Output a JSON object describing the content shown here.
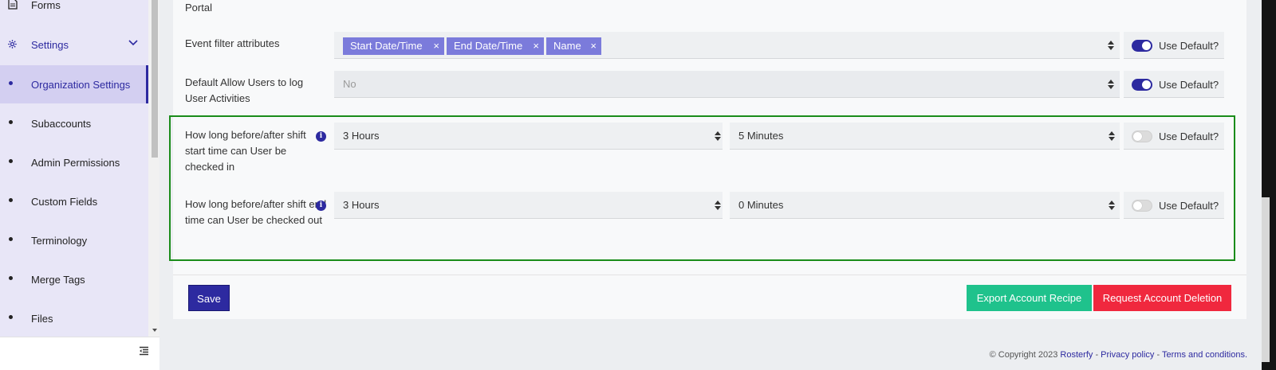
{
  "sidebar": {
    "items": [
      {
        "label": "Forms"
      },
      {
        "label": "Settings"
      },
      {
        "label": "Organization Settings"
      },
      {
        "label": "Subaccounts"
      },
      {
        "label": "Admin Permissions"
      },
      {
        "label": "Custom Fields"
      },
      {
        "label": "Terminology"
      },
      {
        "label": "Merge Tags"
      },
      {
        "label": "Files"
      }
    ]
  },
  "form": {
    "portal_label": "Portal",
    "event_filter": {
      "label": "Event filter attributes",
      "chips": [
        "Start Date/Time",
        "End Date/Time",
        "Name"
      ],
      "chip_remove": "×",
      "use_default_label": "Use Default?",
      "use_default_on": true
    },
    "allow_log": {
      "label": "Default Allow Users to log User Activities",
      "value": "No",
      "use_default_label": "Use Default?",
      "use_default_on": true
    },
    "checkin": {
      "label": "How long before/after shift start time can User be checked in",
      "hours": "3 Hours",
      "minutes": "5 Minutes",
      "use_default_label": "Use Default?",
      "use_default_on": false
    },
    "checkout": {
      "label": "How long before/after shift end time can User be checked out",
      "hours": "3 Hours",
      "minutes": "0 Minutes",
      "use_default_label": "Use Default?",
      "use_default_on": false
    },
    "info_glyph": "i"
  },
  "actions": {
    "save": "Save",
    "export": "Export Account Recipe",
    "delete": "Request Account Deletion"
  },
  "footer": {
    "copyright": "© Copyright 2023 ",
    "brand": "Rosterfy",
    "sep1": " - ",
    "privacy": "Privacy policy",
    "sep2": " - ",
    "terms": "Terms and conditions."
  },
  "colors": {
    "accent": "#2d2aa0",
    "chip": "#7b7bdb",
    "export": "#1fc28c",
    "delete": "#f0283e",
    "highlight": "#1a8c1a"
  }
}
